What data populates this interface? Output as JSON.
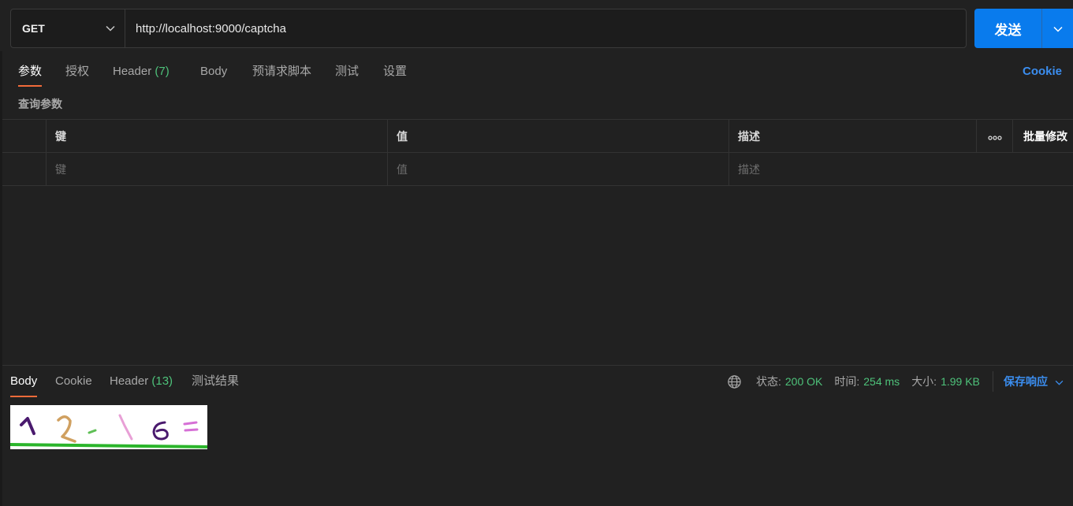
{
  "request": {
    "method": "GET",
    "url": "http://localhost:9000/captcha",
    "send_label": "发送"
  },
  "request_tabs": [
    {
      "label": "参数",
      "active": true
    },
    {
      "label": "授权"
    },
    {
      "label": "Header",
      "count": "(7)"
    },
    {
      "label": "Body"
    },
    {
      "label": "预请求脚本"
    },
    {
      "label": "测试"
    },
    {
      "label": "设置"
    }
  ],
  "cookie_link": "Cookie",
  "params": {
    "section_title": "查询参数",
    "columns": {
      "key": "键",
      "value": "值",
      "description": "描述",
      "more": "∘∘∘",
      "bulk_edit": "批量修改"
    },
    "placeholders": {
      "key": "键",
      "value": "值",
      "description": "描述"
    }
  },
  "response_tabs": [
    {
      "label": "Body",
      "active": true
    },
    {
      "label": "Cookie"
    },
    {
      "label": "Header",
      "count": "(13)"
    },
    {
      "label": "测试结果"
    }
  ],
  "response_meta": {
    "status_label": "状态:",
    "status_value": "200 OK",
    "time_label": "时间:",
    "time_value": "254 ms",
    "size_label": "大小:",
    "size_value": "1.99 KB",
    "save_label": "保存响应"
  },
  "response_body": {
    "captcha_text": "1 2 - 1 6 ="
  },
  "colors": {
    "accent": "#097bed",
    "tab_underline": "#f26b3a",
    "success": "#4ec27a",
    "link": "#3b8ef0"
  }
}
